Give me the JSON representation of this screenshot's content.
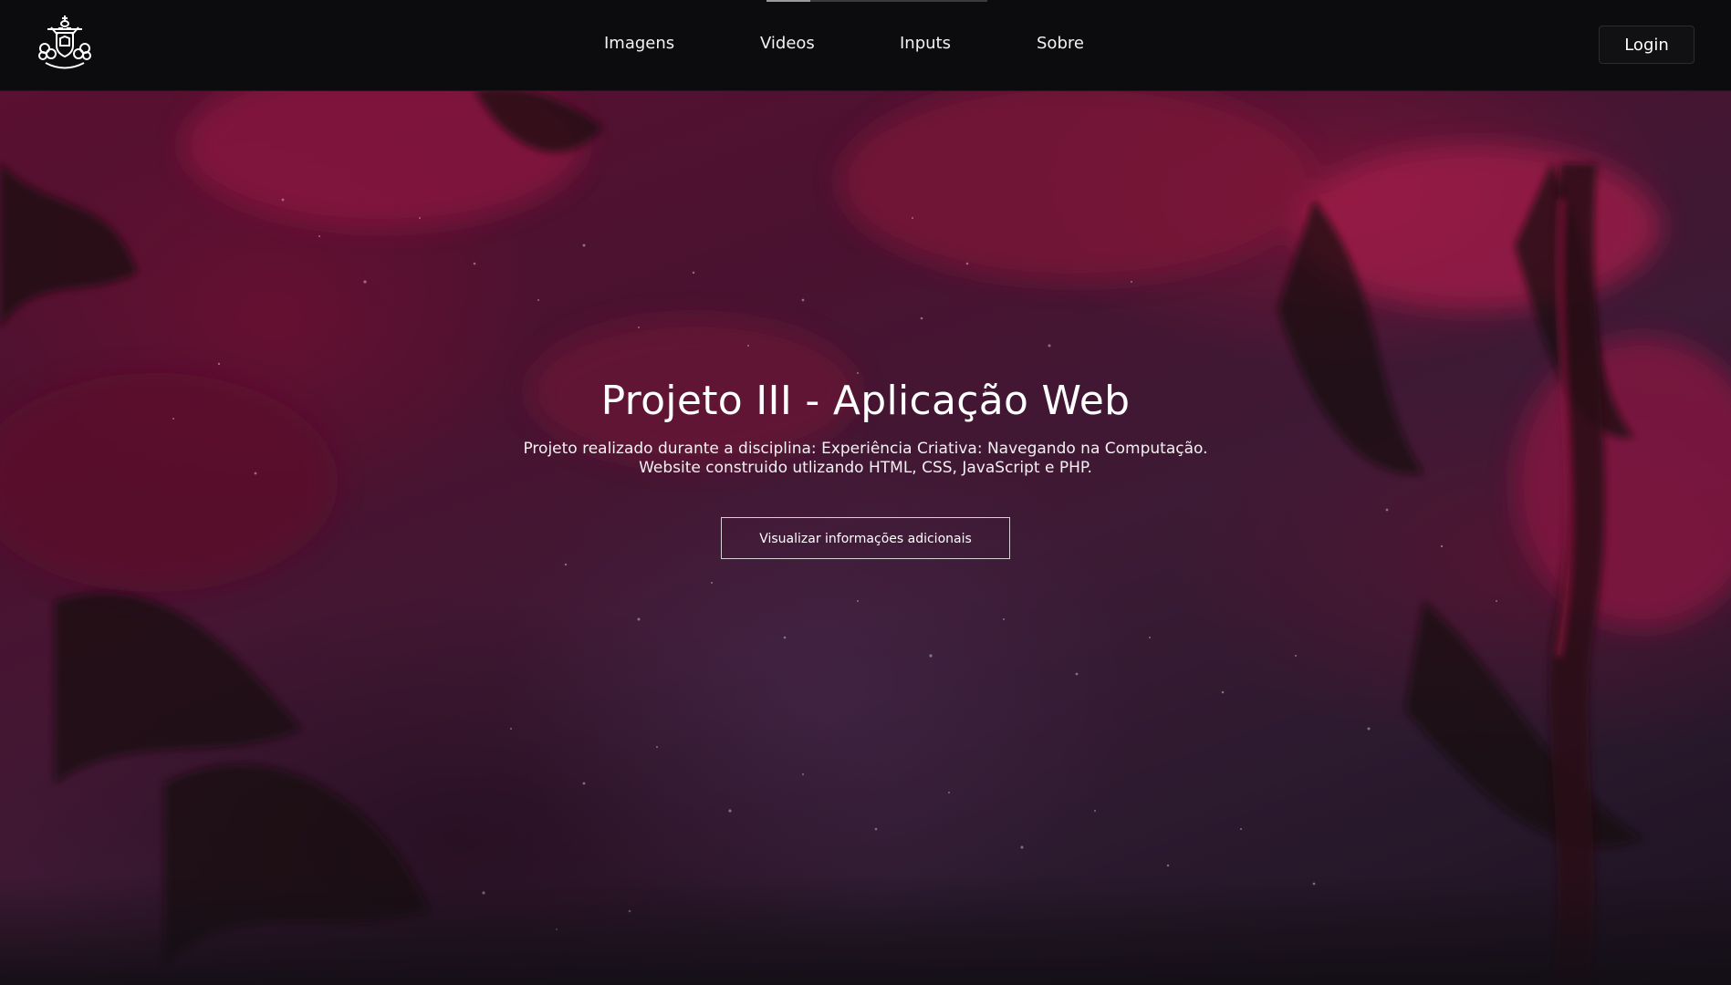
{
  "nav": {
    "logo_icon": "university-crest-icon",
    "links": [
      {
        "label": "Imagens"
      },
      {
        "label": "Videos"
      },
      {
        "label": "Inputs"
      },
      {
        "label": "Sobre"
      }
    ],
    "login_label": "Login"
  },
  "hero": {
    "title": "Projeto III - Aplicação Web",
    "description_line1": "Projeto realizado durante a disciplina: Experiência Criativa: Navegando na Computação.",
    "description_line2": "Website construido utlizando HTML, CSS, JavaScript e PHP.",
    "cta_label": "Visualizar informações adicionais"
  },
  "colors": {
    "nav_background": "#0c0c0f",
    "hero_primary": "#5a1030",
    "hero_secondary": "#2c1a2f",
    "text": "#ffffff"
  }
}
